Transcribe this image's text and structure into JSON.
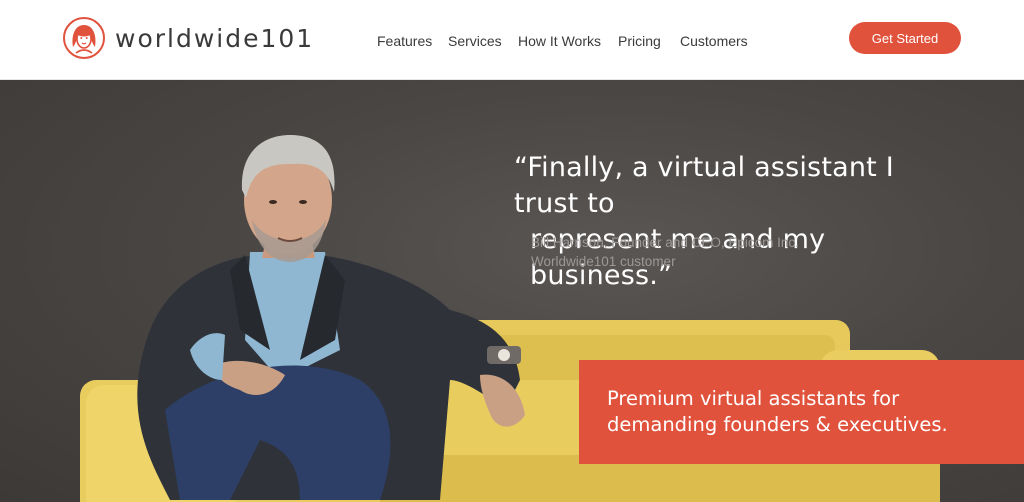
{
  "brand": {
    "name": "worldwide101",
    "accent_color": "#e1523d",
    "logo_icon": "woman-face-logo-icon"
  },
  "nav": {
    "items": [
      "Features",
      "Services",
      "How It Works",
      "Pricing",
      "Customers"
    ],
    "cta_label": "Get Started"
  },
  "hero": {
    "quote_line1": "“Finally, a virtual assistant I trust to",
    "quote_line2": "represent me and my business.”",
    "attribution_line1": "Bill Harrison, Founder and CEO, Epicom Inc.",
    "attribution_line2": "Worldwide101 customer",
    "banner_line1": "Premium virtual assistants for",
    "banner_line2": "demanding founders & executives."
  }
}
